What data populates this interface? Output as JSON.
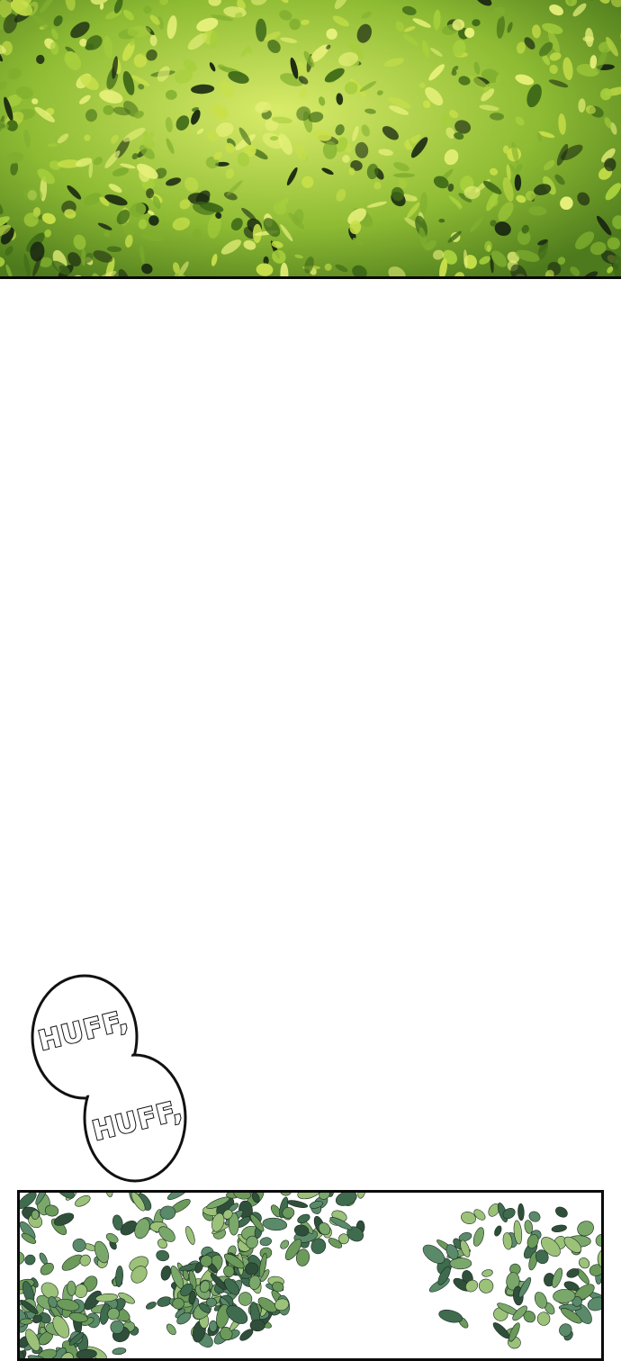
{
  "sfx": {
    "first": "HUFF,",
    "second": "HUFF,"
  },
  "colors": {
    "foliage_light": "#c8e04a",
    "foliage_mid": "#7fae2e",
    "foliage_dark": "#1a2a12",
    "canopy_teal": "#5a8a6a",
    "border": "#0a0a0a",
    "background": "#ffffff"
  }
}
